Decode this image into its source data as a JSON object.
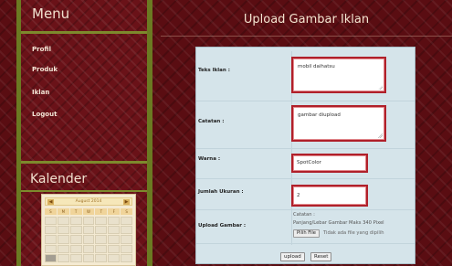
{
  "sidebar": {
    "menu_title": "Menu",
    "items": [
      {
        "label": "Profil"
      },
      {
        "label": "Produk"
      },
      {
        "label": "Iklan"
      },
      {
        "label": "Logout"
      }
    ],
    "calendar_title": "Kalender",
    "calendar": {
      "month": "August 2014",
      "prev": "◀",
      "next": "▶",
      "days": [
        "S",
        "M",
        "T",
        "W",
        "T",
        "F",
        "S"
      ]
    }
  },
  "main": {
    "title": "Upload Gambar Iklan",
    "form": {
      "teks_iklan": {
        "label": "Teks Iklan :",
        "value": "mobil daihatsu"
      },
      "catatan": {
        "label": "Catatan :",
        "value": "gambar diupload"
      },
      "warna": {
        "label": "Warna :",
        "value": "SpotColor"
      },
      "jumlah_ukuran": {
        "label": "Jumlah Ukuran :",
        "value": "2"
      },
      "upload_gambar": {
        "label": "Upload Gambar :",
        "note_title": "Catatan :",
        "note_text": "Panjang/Lebar Gambar Maks 340 Pixel",
        "file_button": "Pilih File",
        "file_status": "Tidak ada file yang dipilih"
      },
      "upload_button": "upload",
      "reset_button": "Reset"
    }
  },
  "colors": {
    "background": "#5a0d12",
    "sidebar_border": "#6b7a22",
    "panel": "#d5e4ea",
    "field_border": "#b0202a"
  }
}
